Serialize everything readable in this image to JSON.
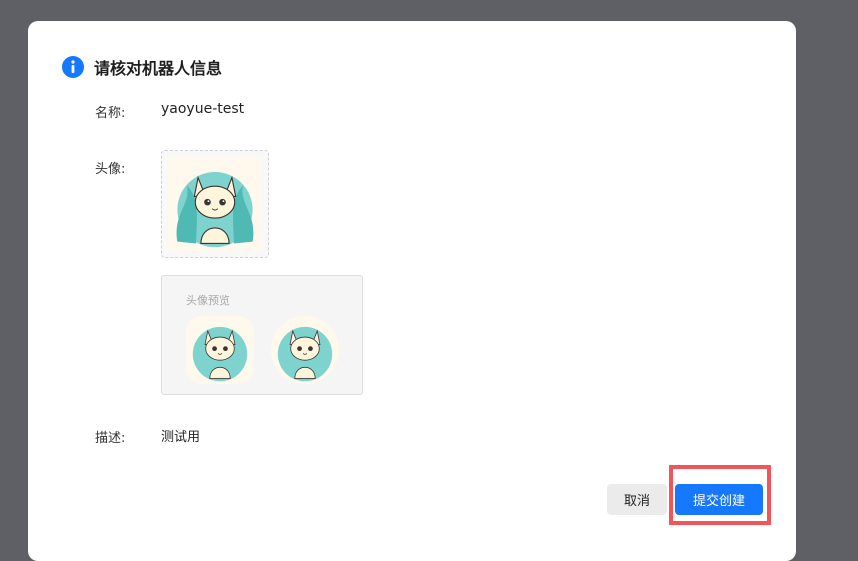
{
  "dialog": {
    "title": "请核对机器人信息",
    "icon": "info-icon"
  },
  "fields": {
    "name_label": "名称:",
    "name_value": "yaoyue-test",
    "avatar_label": "头像:",
    "preview_label": "头像预览",
    "description_label": "描述:",
    "description_value": "测试用"
  },
  "buttons": {
    "cancel": "取消",
    "submit": "提交创建"
  },
  "colors": {
    "primary": "#1677ff",
    "highlight": "#f2545b",
    "overlay": "#5f6066"
  }
}
